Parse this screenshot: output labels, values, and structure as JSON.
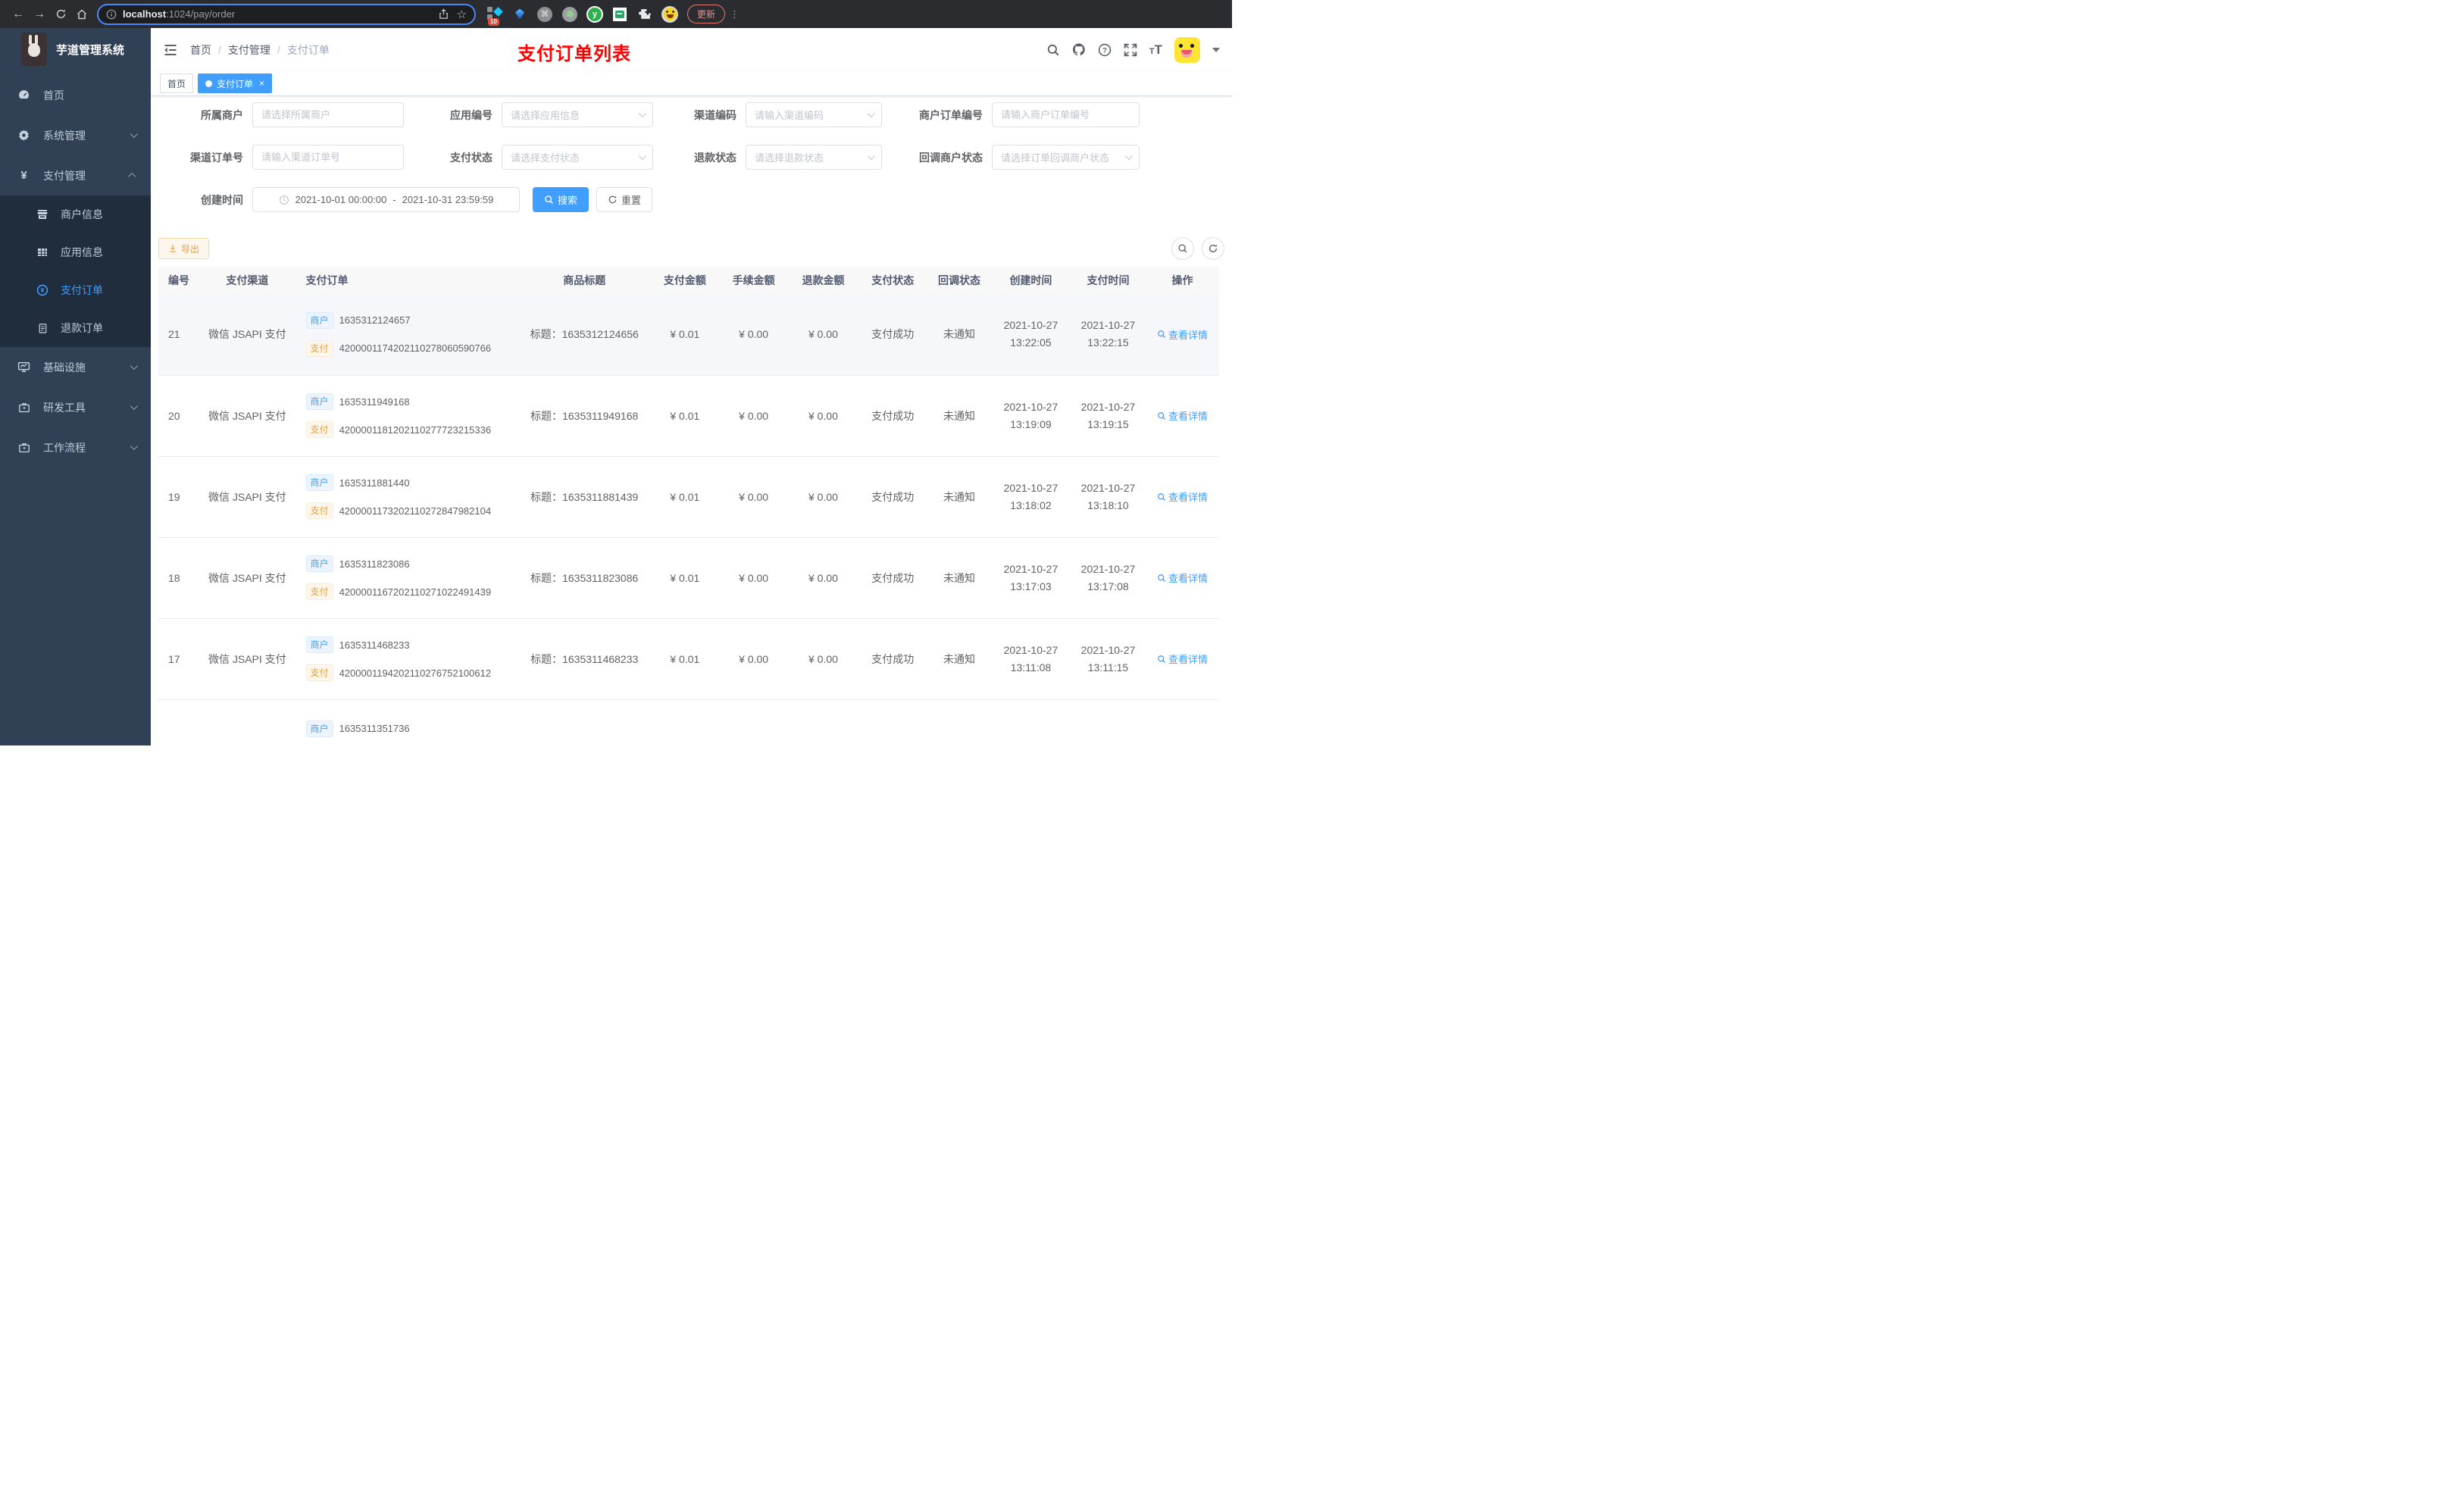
{
  "browser": {
    "host": "localhost",
    "path_rest": ":1024/pay/order",
    "extension_badge": "10",
    "update_label": "更新",
    "menu_dots": "⋮"
  },
  "sidebar": {
    "title": "芋道管理系统",
    "menu": [
      {
        "label": "首页"
      },
      {
        "label": "系统管理"
      },
      {
        "label": "支付管理",
        "children": [
          {
            "label": "商户信息"
          },
          {
            "label": "应用信息"
          },
          {
            "label": "支付订单"
          },
          {
            "label": "退款订单"
          }
        ]
      },
      {
        "label": "基础设施"
      },
      {
        "label": "研发工具"
      },
      {
        "label": "工作流程"
      }
    ]
  },
  "header": {
    "breadcrumb": [
      "首页",
      "支付管理",
      "支付订单"
    ],
    "banner": "支付订单列表",
    "fontsize_small": "T",
    "fontsize_big": "T"
  },
  "tabs": [
    {
      "label": "首页"
    },
    {
      "label": "支付订单",
      "close": "×"
    }
  ],
  "filters": {
    "fields": [
      {
        "label": "所属商户",
        "placeholder": "请选择所属商户"
      },
      {
        "label": "应用编号",
        "placeholder": "请选择应用信息"
      },
      {
        "label": "渠道编码",
        "placeholder": "请输入渠道编码"
      },
      {
        "label": "商户订单编号",
        "placeholder": "请输入商户订单编号"
      },
      {
        "label": "渠道订单号",
        "placeholder": "请输入渠道订单号"
      },
      {
        "label": "支付状态",
        "placeholder": "请选择支付状态"
      },
      {
        "label": "退款状态",
        "placeholder": "请选择退款状态"
      },
      {
        "label": "回调商户状态",
        "placeholder": "请选择订单回调商户状态"
      }
    ],
    "date": {
      "label": "创建时间",
      "start": "2021-10-01 00:00:00",
      "separator": "-",
      "end": "2021-10-31 23:59:59"
    },
    "search_label": "搜索",
    "reset_label": "重置"
  },
  "toolbar": {
    "export_label": "导出"
  },
  "table": {
    "columns": [
      "编号",
      "支付渠道",
      "支付订单",
      "商品标题",
      "支付金额",
      "手续金额",
      "退款金额",
      "支付状态",
      "回调状态",
      "创建时间",
      "支付时间",
      "操作"
    ],
    "tag_merchant": "商户",
    "tag_channel": "支付",
    "action_label": "查看详情",
    "rows": [
      {
        "id": "21",
        "channel": "微信 JSAPI 支付",
        "merchant_no": "1635312124657",
        "channel_no": "4200001174202110278060590766",
        "title": "标题：1635312124656",
        "amount": "¥ 0.01",
        "fee": "¥ 0.00",
        "refund": "¥ 0.00",
        "status": "支付成功",
        "notify": "未通知",
        "created_date": "2021-10-27",
        "created_time": "13:22:05",
        "paid_date": "2021-10-27",
        "paid_time": "13:22:15"
      },
      {
        "id": "20",
        "channel": "微信 JSAPI 支付",
        "merchant_no": "1635311949168",
        "channel_no": "4200001181202110277723215336",
        "title": "标题：1635311949168",
        "amount": "¥ 0.01",
        "fee": "¥ 0.00",
        "refund": "¥ 0.00",
        "status": "支付成功",
        "notify": "未通知",
        "created_date": "2021-10-27",
        "created_time": "13:19:09",
        "paid_date": "2021-10-27",
        "paid_time": "13:19:15"
      },
      {
        "id": "19",
        "channel": "微信 JSAPI 支付",
        "merchant_no": "1635311881440",
        "channel_no": "4200001173202110272847982104",
        "title": "标题：1635311881439",
        "amount": "¥ 0.01",
        "fee": "¥ 0.00",
        "refund": "¥ 0.00",
        "status": "支付成功",
        "notify": "未通知",
        "created_date": "2021-10-27",
        "created_time": "13:18:02",
        "paid_date": "2021-10-27",
        "paid_time": "13:18:10"
      },
      {
        "id": "18",
        "channel": "微信 JSAPI 支付",
        "merchant_no": "1635311823086",
        "channel_no": "4200001167202110271022491439",
        "title": "标题：1635311823086",
        "amount": "¥ 0.01",
        "fee": "¥ 0.00",
        "refund": "¥ 0.00",
        "status": "支付成功",
        "notify": "未通知",
        "created_date": "2021-10-27",
        "created_time": "13:17:03",
        "paid_date": "2021-10-27",
        "paid_time": "13:17:08"
      },
      {
        "id": "17",
        "channel": "微信 JSAPI 支付",
        "merchant_no": "1635311468233",
        "channel_no": "4200001194202110276752100612",
        "title": "标题：1635311468233",
        "amount": "¥ 0.01",
        "fee": "¥ 0.00",
        "refund": "¥ 0.00",
        "status": "支付成功",
        "notify": "未通知",
        "created_date": "2021-10-27",
        "created_time": "13:11:08",
        "paid_date": "2021-10-27",
        "paid_time": "13:11:15"
      }
    ],
    "partial_row": {
      "merchant_no": "1635311351736"
    }
  },
  "colors": {
    "accent": "#409eff",
    "warning": "#e6a23c",
    "banner_red": "#ff0000",
    "sidebar_bg": "#304156",
    "submenu_bg": "#1f2d3d",
    "active_tab": "#409eff"
  }
}
